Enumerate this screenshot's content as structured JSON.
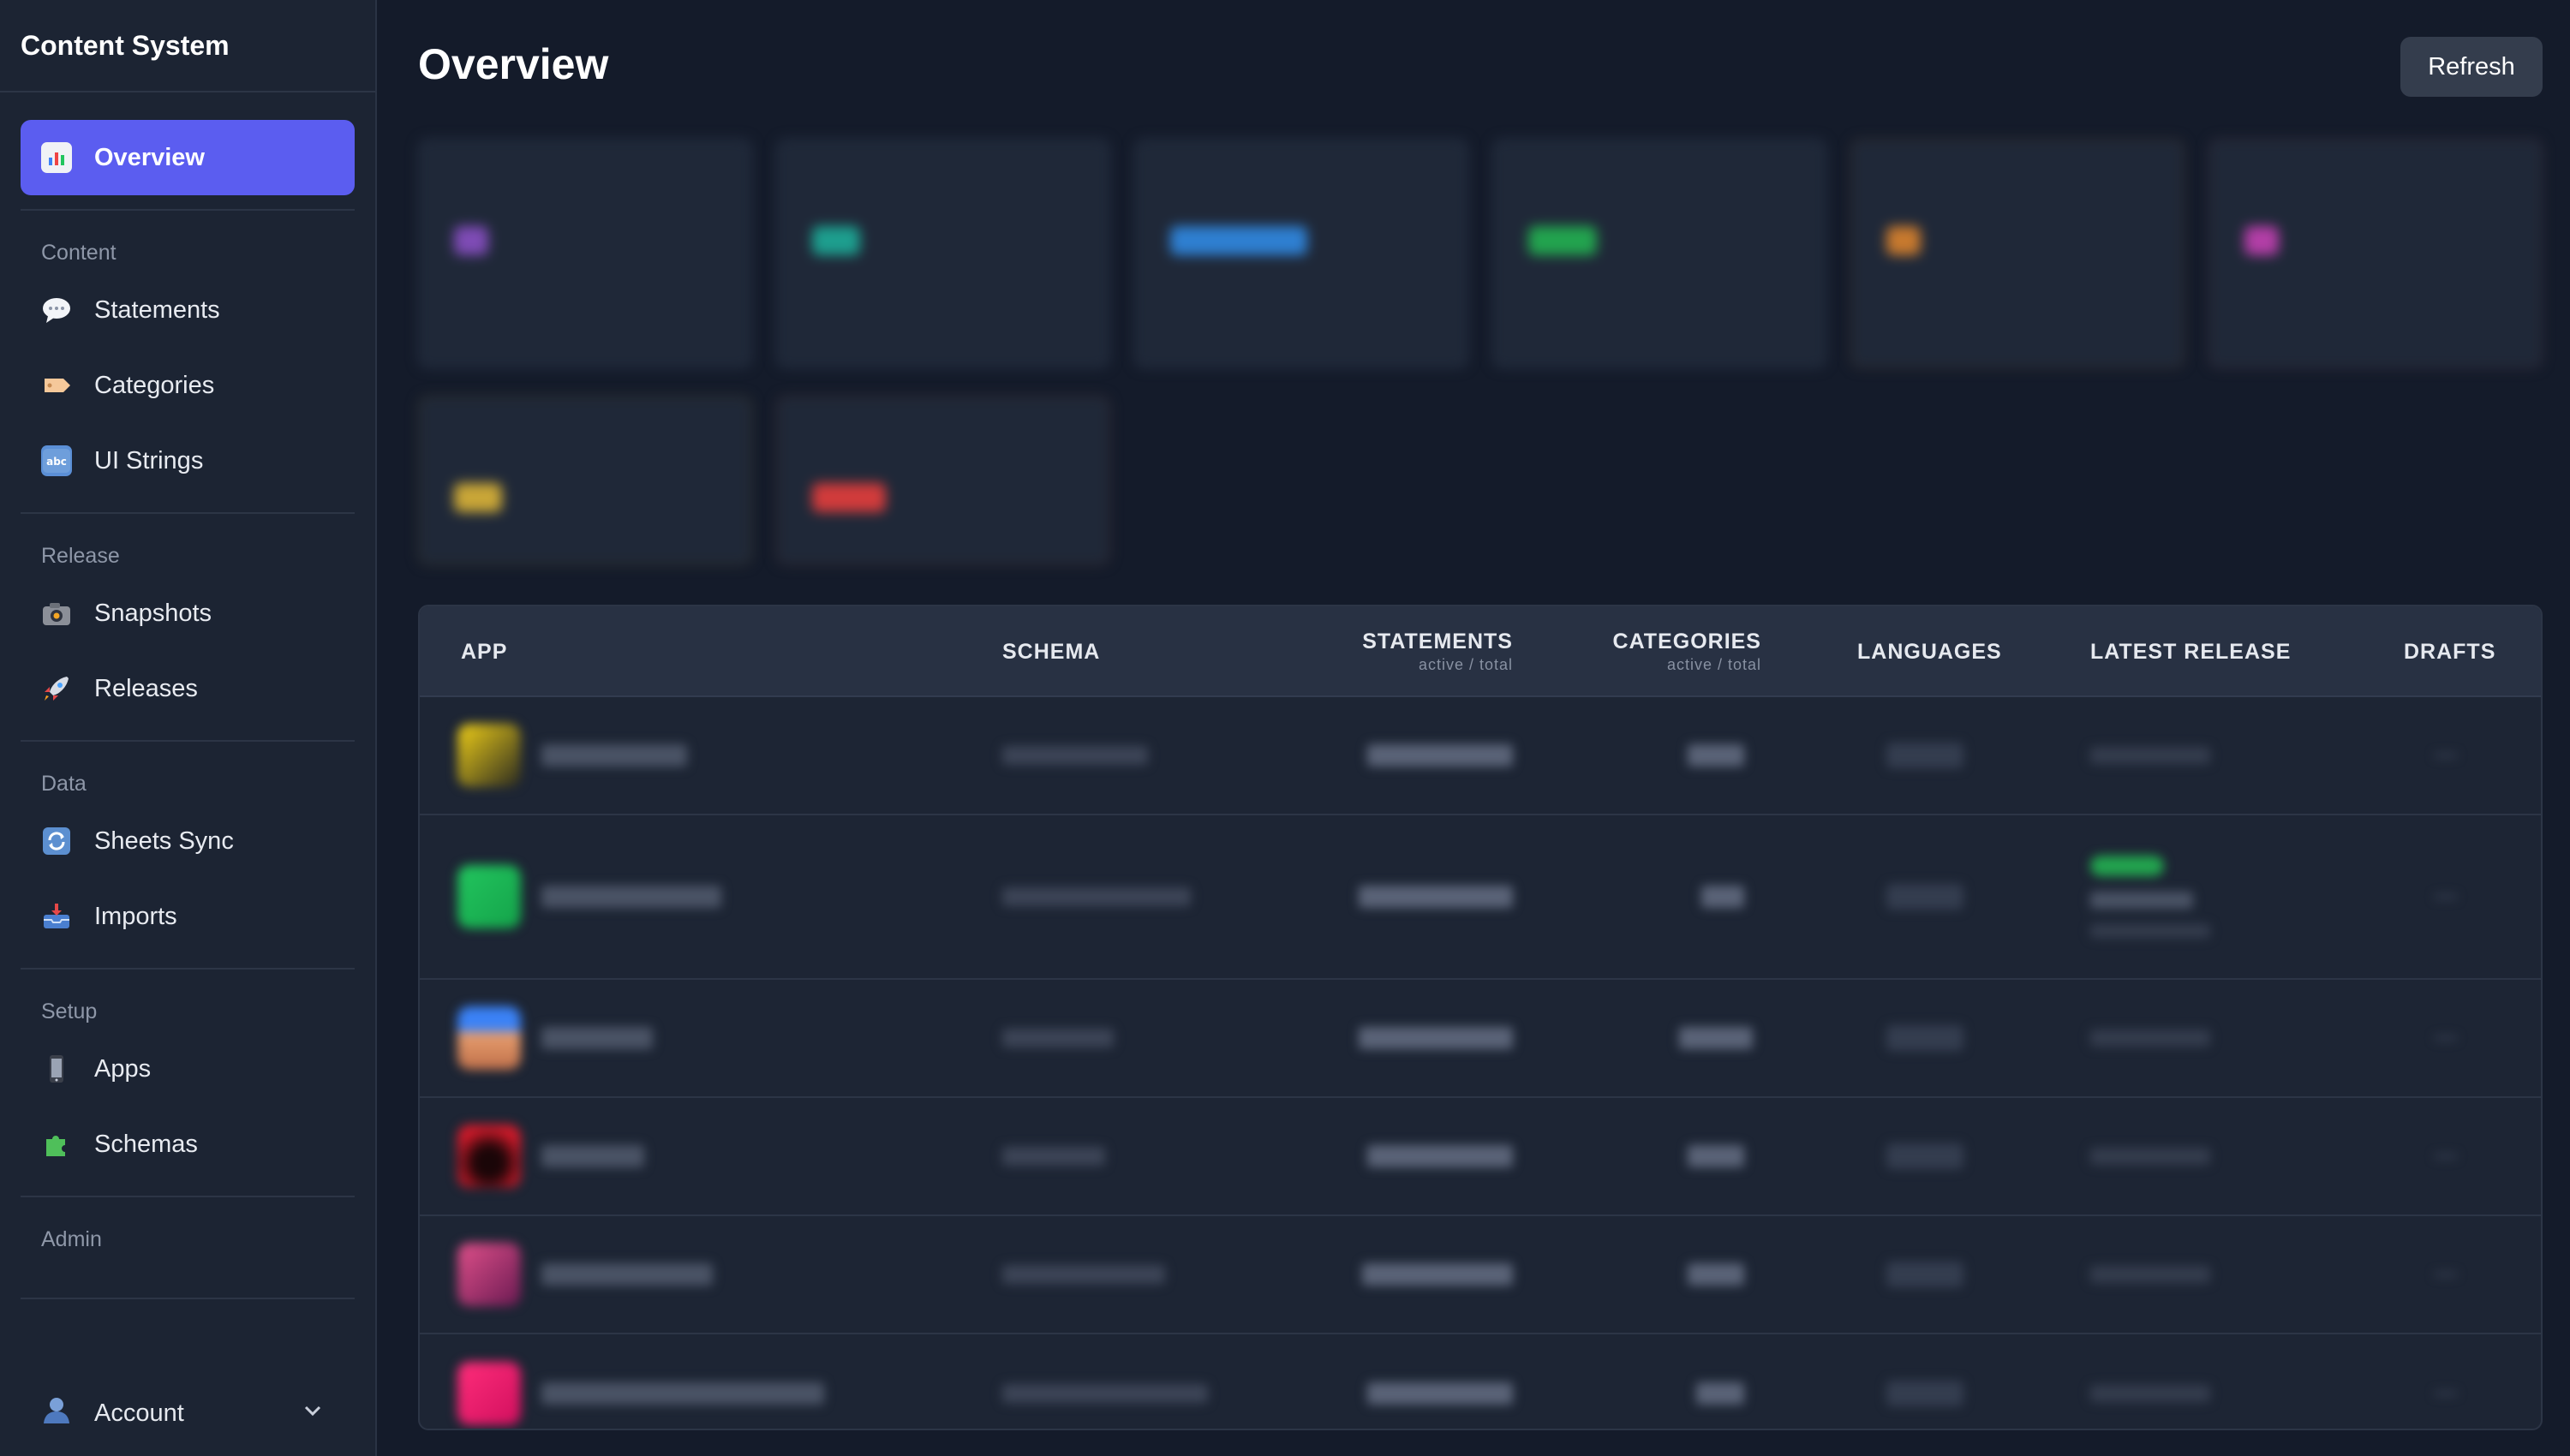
{
  "sidebar": {
    "brand": "Content System",
    "active_item": {
      "label": "Overview",
      "icon": "chart-icon"
    },
    "sections": [
      {
        "label": "Content",
        "items": [
          {
            "label": "Statements",
            "icon": "speech-bubble-icon"
          },
          {
            "label": "Categories",
            "icon": "tag-icon"
          },
          {
            "label": "UI Strings",
            "icon": "abc-icon"
          }
        ]
      },
      {
        "label": "Release",
        "items": [
          {
            "label": "Snapshots",
            "icon": "camera-icon"
          },
          {
            "label": "Releases",
            "icon": "rocket-icon"
          }
        ]
      },
      {
        "label": "Data",
        "items": [
          {
            "label": "Sheets Sync",
            "icon": "sync-icon"
          },
          {
            "label": "Imports",
            "icon": "inbox-icon"
          }
        ]
      },
      {
        "label": "Setup",
        "items": [
          {
            "label": "Apps",
            "icon": "phone-icon"
          },
          {
            "label": "Schemas",
            "icon": "puzzle-icon"
          }
        ]
      },
      {
        "label": "Admin",
        "items": []
      }
    ],
    "account": {
      "label": "Account",
      "icon": "user-icon",
      "chevron": "chevron-down-icon"
    }
  },
  "header": {
    "title": "Overview",
    "refresh_label": "Refresh"
  },
  "table": {
    "columns": [
      {
        "label": "APP",
        "sub": ""
      },
      {
        "label": "SCHEMA",
        "sub": ""
      },
      {
        "label": "STATEMENTS",
        "sub": "active / total"
      },
      {
        "label": "CATEGORIES",
        "sub": "active / total"
      },
      {
        "label": "LANGUAGES",
        "sub": ""
      },
      {
        "label": "LATEST RELEASE",
        "sub": ""
      },
      {
        "label": "DRAFTS",
        "sub": ""
      }
    ]
  },
  "colors": {
    "accent": "#5b5df0",
    "background": "#141b2a",
    "sidebar": "#1c2433",
    "table_header": "#283143"
  }
}
